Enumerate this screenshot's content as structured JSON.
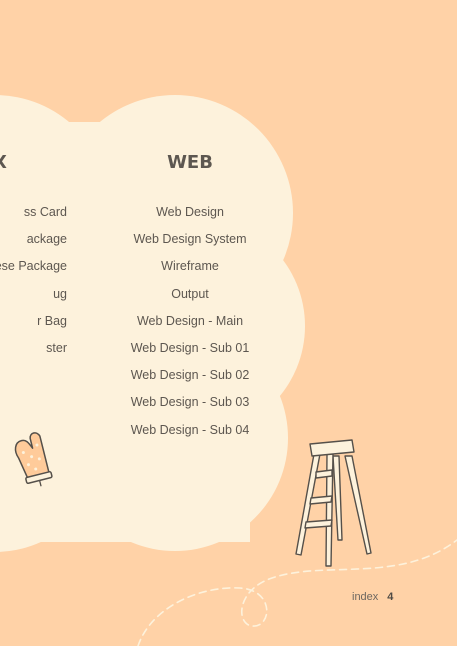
{
  "columns": {
    "left": {
      "title": "X",
      "items": [
        "ss Card",
        "ackage",
        "ese Package",
        "ug",
        "r Bag",
        "ster"
      ]
    },
    "web": {
      "title": "WEB",
      "items": [
        "Web Design",
        "Web Design System",
        "Wireframe",
        "Output",
        "Web Design - Main",
        "Web Design - Sub 01",
        "Web Design - Sub 02",
        "Web Design - Sub 03",
        "Web Design - Sub 04"
      ]
    }
  },
  "footer": {
    "label": "index",
    "page_number": "4"
  },
  "colors": {
    "background": "#ffd2a7",
    "cloud": "#fdf2dc",
    "text": "#5d5750",
    "outline": "#55504a"
  },
  "illustrations": [
    "oven-mitt-icon",
    "ladder-icon",
    "dashed-path"
  ]
}
